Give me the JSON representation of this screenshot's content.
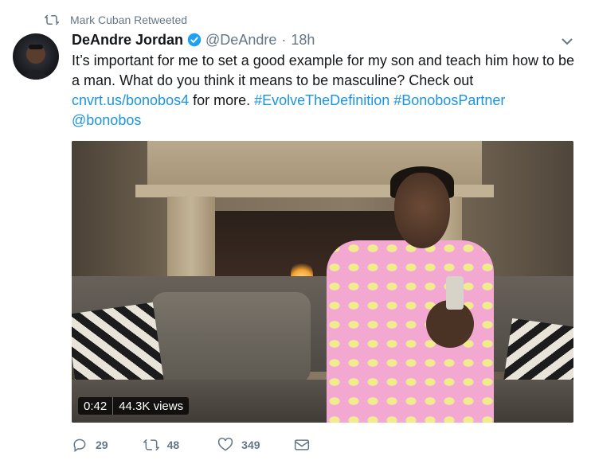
{
  "retweet_context": {
    "label": "Mark Cuban Retweeted"
  },
  "author": {
    "name": "DeAndre Jordan",
    "handle": "@DeAndre",
    "separator": "·",
    "time": "18h"
  },
  "tweet": {
    "text_1": "It’s important for me to set a good example for my son and teach him how to be a man. What do you think it means to be masculine? Check out ",
    "link": "cnvrt.us/bonobos4",
    "text_2": " for more. ",
    "hashtag_1": "#EvolveTheDefinition",
    "space": " ",
    "hashtag_2": "#BonobosPartner",
    "mention": "@bonobos"
  },
  "video": {
    "duration": "0:42",
    "views": "44.3K views"
  },
  "actions": {
    "replies": "29",
    "retweets": "48",
    "likes": "349"
  },
  "colors": {
    "link": "#1b95e0",
    "meta": "#657786",
    "text": "#14171a",
    "verified": "#1da1f2"
  },
  "icons": [
    "retweet-icon",
    "verified-badge-icon",
    "chevron-down-icon",
    "reply-icon",
    "retweet-icon",
    "heart-icon",
    "direct-message-icon"
  ]
}
